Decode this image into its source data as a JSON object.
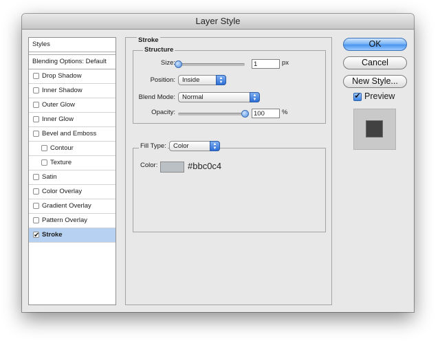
{
  "window": {
    "title": "Layer Style"
  },
  "styles": {
    "header": "Styles",
    "blending_options": "Blending Options: Default",
    "items": [
      {
        "label": "Drop Shadow",
        "checked": false,
        "indent": false,
        "selected": false
      },
      {
        "label": "Inner Shadow",
        "checked": false,
        "indent": false,
        "selected": false
      },
      {
        "label": "Outer Glow",
        "checked": false,
        "indent": false,
        "selected": false
      },
      {
        "label": "Inner Glow",
        "checked": false,
        "indent": false,
        "selected": false
      },
      {
        "label": "Bevel and Emboss",
        "checked": false,
        "indent": false,
        "selected": false
      },
      {
        "label": "Contour",
        "checked": false,
        "indent": true,
        "selected": false
      },
      {
        "label": "Texture",
        "checked": false,
        "indent": true,
        "selected": false
      },
      {
        "label": "Satin",
        "checked": false,
        "indent": false,
        "selected": false
      },
      {
        "label": "Color Overlay",
        "checked": false,
        "indent": false,
        "selected": false
      },
      {
        "label": "Gradient Overlay",
        "checked": false,
        "indent": false,
        "selected": false
      },
      {
        "label": "Pattern Overlay",
        "checked": false,
        "indent": false,
        "selected": false
      },
      {
        "label": "Stroke",
        "checked": true,
        "indent": false,
        "selected": true
      }
    ]
  },
  "stroke": {
    "section_title": "Stroke",
    "structure_title": "Structure",
    "size_label": "Size:",
    "size_value": "1",
    "size_unit": "px",
    "size_slider_fraction": 0.0,
    "position_label": "Position:",
    "position_value": "Inside",
    "blend_mode_label": "Blend Mode:",
    "blend_mode_value": "Normal",
    "opacity_label": "Opacity:",
    "opacity_value": "100",
    "opacity_unit": "%",
    "opacity_slider_fraction": 1.0,
    "fill_type_label": "Fill Type:",
    "fill_type_value": "Color",
    "color_label": "Color:",
    "color_hex": "#bbc0c4",
    "color_swatch": "#bbc0c4"
  },
  "buttons": {
    "ok": "OK",
    "cancel": "Cancel",
    "new_style": "New Style...",
    "preview_label": "Preview",
    "preview_checked": true
  },
  "colors": {
    "selection": "#b7d1f2",
    "accent": "#4a95ee",
    "preview_square": "#414141"
  }
}
